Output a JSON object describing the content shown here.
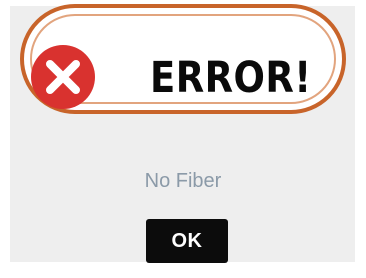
{
  "dialog": {
    "title": "ERROR!",
    "icon": "error-x-icon",
    "message": "No Fiber",
    "ok_label": "OK"
  },
  "colors": {
    "accent_border": "#c8642a",
    "error_red": "#d9322f",
    "message_text": "#8b9aa8",
    "button_bg": "#0c0c0c",
    "dialog_bg": "#eeeeee"
  }
}
